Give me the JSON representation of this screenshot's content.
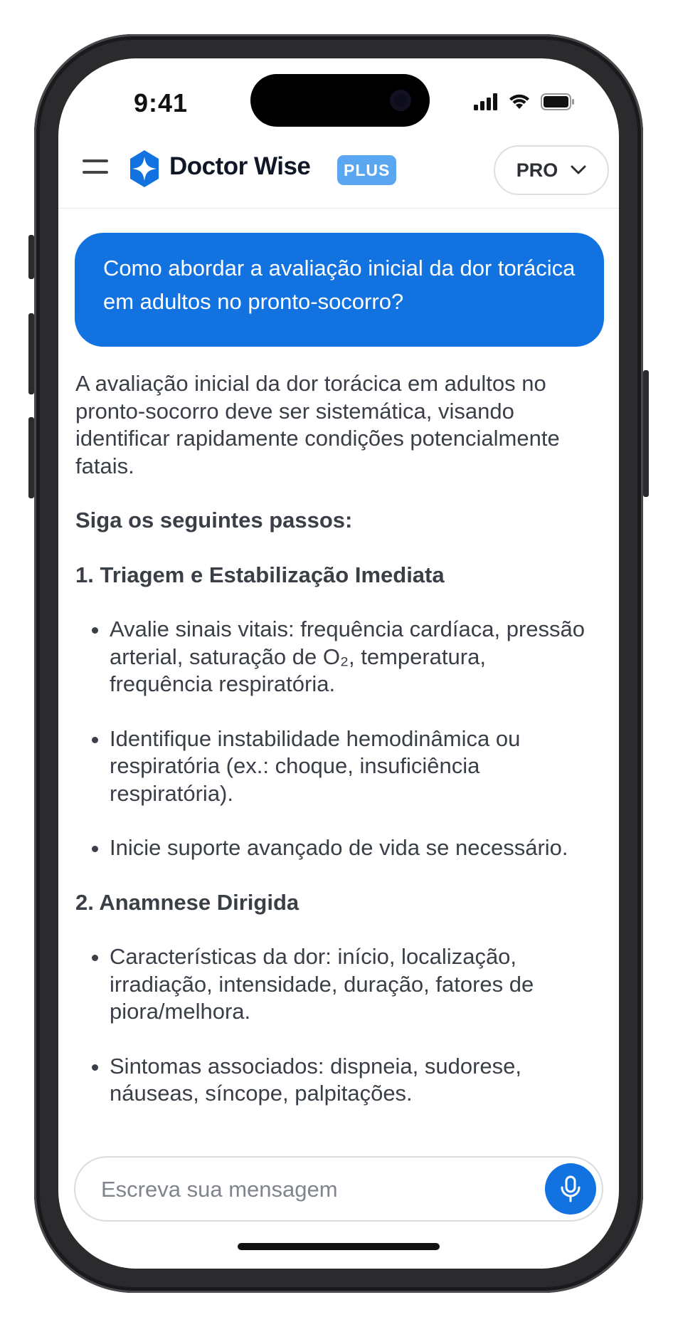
{
  "status_bar": {
    "time": "9:41"
  },
  "header": {
    "brand": "Doctor Wise",
    "badge": "PLUS",
    "plan_label": "PRO"
  },
  "user_message": "Como abordar a avaliação inicial da dor torácica em adultos no pronto-socorro?",
  "answer": {
    "intro": "A avaliação inicial da dor torácica em adultos no pronto-socorro deve ser sistemática, visando identificar rapidamente condições potencialmente fatais.",
    "steps_heading": "Siga os seguintes passos:",
    "sections": [
      {
        "heading": "1. Triagem e Estabilização Imediata",
        "items": [
          "Avalie sinais vitais: frequência cardíaca, pressão arterial, saturação de O₂, temperatura, frequência respiratória.",
          "Identifique instabilidade hemodinâmica ou respiratória (ex.: choque, insuficiência respiratória).",
          "Inicie suporte avançado de vida se necessário."
        ]
      },
      {
        "heading": "2. Anamnese Dirigida",
        "items": [
          "Características da dor: início, localização, irradiação, intensidade, duração, fatores de piora/melhora.",
          "Sintomas associados: dispneia, sudorese, náuseas, síncope, palpitações."
        ]
      }
    ]
  },
  "composer": {
    "placeholder": "Escreva sua mensagem"
  },
  "colors": {
    "accent": "#1273e0",
    "badge": "#5aa6f0",
    "text": "#3a3f47"
  },
  "icons": {
    "menu": "hamburger-menu-icon",
    "logo": "doctor-wise-logo",
    "dropdown": "chevron-down-icon",
    "mic": "microphone-icon"
  }
}
